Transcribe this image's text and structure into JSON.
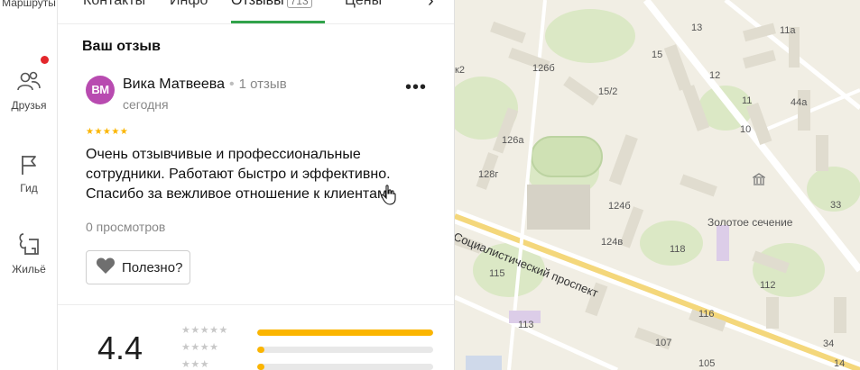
{
  "rail": {
    "items": [
      {
        "label": "Маршруты",
        "icon": "route-icon"
      },
      {
        "label": "Друзья",
        "icon": "friends-icon"
      },
      {
        "label": "Гид",
        "icon": "flag-icon"
      },
      {
        "label": "Жильё",
        "icon": "housing-icon"
      }
    ]
  },
  "tabs": {
    "items": [
      "Контакты",
      "Инфо",
      "Отзывы",
      "Цены"
    ],
    "badge": "713"
  },
  "review": {
    "section_title": "Ваш отзыв",
    "avatar_initials": "ВМ",
    "author": "Вика Матвеева",
    "review_count": "1 отзыв",
    "date": "сегодня",
    "more": "•••",
    "stars": "★★★★★",
    "rating_value": 5,
    "text": "Очень отзывчивые и профессиональные сотрудники. Работают быстро и эффективно. Спасибо за вежливое отношение к клиентам.",
    "views": "0 просмотров",
    "useful_label": "Полезно?"
  },
  "summary": {
    "rating": "4.4",
    "rows": [
      {
        "stars": "★★★★★",
        "fraction": 1.0
      },
      {
        "stars": "★★★★",
        "fraction": 0.04
      },
      {
        "stars": "★★★",
        "fraction": 0.03
      }
    ]
  },
  "map": {
    "street": "Социалистический проспект",
    "poi": "Золотое сечение",
    "buildings": [
      "к2",
      "126б",
      "15",
      "13",
      "11а",
      "12",
      "15/2",
      "44а",
      "11",
      "126а",
      "10",
      "128г",
      "124б",
      "33",
      "124в",
      "118",
      "115",
      "112",
      "116",
      "113",
      "107",
      "105",
      "34",
      "14"
    ]
  },
  "colors": {
    "accent_green": "#31a34a",
    "star_yellow": "#fbb500",
    "avatar_bg": "#b84bb0",
    "notify_red": "#e3262b"
  }
}
